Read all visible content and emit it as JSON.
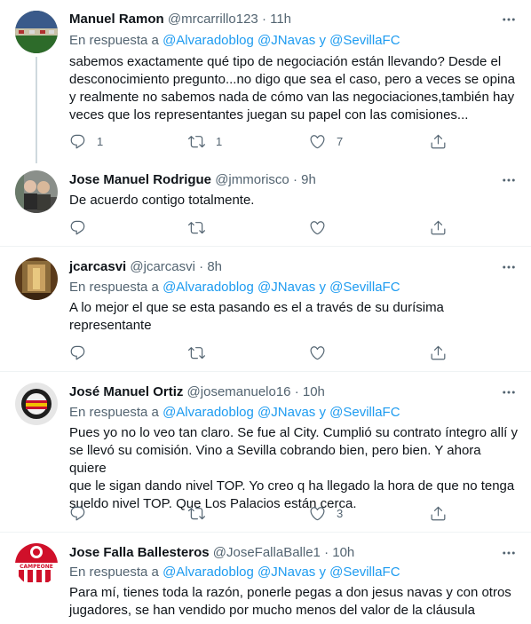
{
  "reply_prefix": "En respuesta a",
  "and_word": "y",
  "tweets": [
    {
      "name": "Manuel Ramon",
      "handle": "@mrcarrillo123",
      "time": "· 11h",
      "mentions": [
        "@Alvaradoblog",
        "@JNavas",
        "@SevillaFC"
      ],
      "lines": [
        "sabemos exactamente qué tipo de negociación están llevando? Desde el",
        "desconocimiento pregunto...no digo que sea el caso, pero a veces se opina",
        "y realmente no sabemos nada de cómo van las negociaciones,también hay",
        "veces que los representantes juegan su papel con las comisiones..."
      ],
      "replies": "1",
      "retweets": "1",
      "likes": "7"
    },
    {
      "name": "Jose Manuel Rodrigue",
      "handle": "@jmmorisco",
      "time": "· 9h",
      "lines": [
        "De acuerdo contigo totalmente."
      ],
      "replies": "",
      "retweets": "",
      "likes": ""
    },
    {
      "name": "jcarcasvi",
      "handle": "@jcarcasvi",
      "time": "· 8h",
      "mentions": [
        "@Alvaradoblog",
        "@JNavas",
        "@SevillaFC"
      ],
      "lines": [
        "A lo mejor el que se esta pasando es el a través de su durísima",
        "representante"
      ],
      "replies": "",
      "retweets": "",
      "likes": ""
    },
    {
      "name": "José Manuel Ortiz",
      "handle": "@josemanuelo16",
      "time": "· 10h",
      "mentions": [
        "@Alvaradoblog",
        "@JNavas",
        "@SevillaFC"
      ],
      "lines": [
        "Pues yo no lo veo tan claro. Se fue al City. Cumplió su contrato íntegro allí y",
        "se llevó su comisión. Vino a Sevilla cobrando bien, pero bien. Y ahora quiere",
        "que le sigan dando nivel TOP. Yo creo q ha llegado la hora de que no tenga",
        "sueldo nivel TOP. Que Los Palacios están cerca."
      ],
      "replies": "",
      "retweets": "",
      "likes": "3"
    },
    {
      "name": "Jose Falla Ballesteros",
      "handle": "@JoseFallaBalle1",
      "time": "· 10h",
      "mentions": [
        "@Alvaradoblog",
        "@JNavas",
        "@SevillaFC"
      ],
      "lines": [
        "Para mí, tienes toda la razón, ponerle pegas a don jesus navas y con otros",
        "jugadores, se han vendido por mucho menos del valor de la cláusula"
      ],
      "avatar_text": "CAMPEONE"
    }
  ],
  "colors": {
    "link": "#1d9bf0",
    "muted": "#536471",
    "divider": "#eff3f4"
  }
}
